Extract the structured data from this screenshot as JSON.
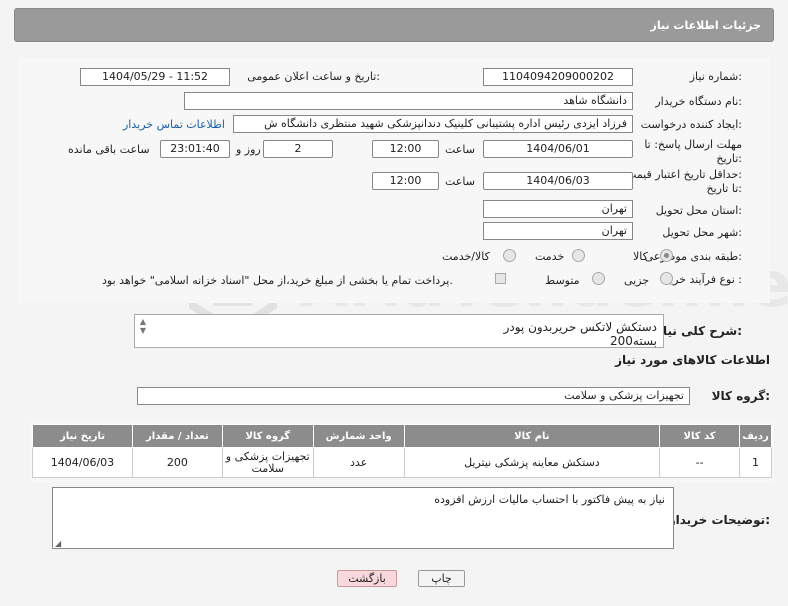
{
  "header": {
    "title": "جزئیات اطلاعات نیاز"
  },
  "form": {
    "need_number_label": "شماره نیاز:",
    "need_number": "1104094209000202",
    "announce_label": "تاریخ و ساعت اعلان عمومی:",
    "announce_value": "1404/05/29 - 11:52",
    "buyer_org_label": "نام دستگاه خریدار:",
    "buyer_org": "دانشگاه شاهد",
    "creator_label": "ایجاد کننده درخواست:",
    "creator": "فرزاد ایزدی رئیس اداره پشتیبانی کلینیک دندانپزشکی شهید منتظری دانشگاه ش",
    "contact_link": "اطلاعات تماس خریدار",
    "deadline_label_1": "مهلت ارسال پاسخ: تا",
    "deadline_label_2": "تاریخ:",
    "deadline_date": "1404/06/01",
    "time_label": "ساعت",
    "deadline_time": "12:00",
    "days_value": "2",
    "days_label": "روز و",
    "remaining_time": "23:01:40",
    "remaining_label": "ساعت باقی مانده",
    "price_validity_label_1": "حداقل تاریخ اعتبار قیمت:",
    "price_validity_label_2": "تا تاریخ:",
    "price_validity_date": "1404/06/03",
    "price_validity_time": "12:00",
    "province_label": "استان محل تحویل:",
    "province": "تهران",
    "city_label": "شهر محل تحویل:",
    "city": "تهران",
    "category_label": "طبقه بندی موضوعی:",
    "category_options": [
      "کالا",
      "خدمت",
      "کالا/خدمت"
    ],
    "category_selected": "کالا",
    "process_label": "نوع فرآیند خرید :",
    "process_options": [
      "جزیی",
      "متوسط"
    ],
    "payment_note": "پرداخت تمام یا بخشی از مبلغ خرید،از محل \"اسناد خزانه اسلامی\" خواهد بود."
  },
  "description": {
    "label": "شرح کلی نیاز:",
    "line1": "دستکش لاتکس حریربدون پودر",
    "line2": "200بسته"
  },
  "goods": {
    "section_title": "اطلاعات کالاهای مورد نیاز",
    "group_label": "گروه کالا:",
    "group_value": "تجهیزات پزشکی و سلامت",
    "columns": [
      "ردیف",
      "کد کالا",
      "نام کالا",
      "واحد شمارش",
      "گروه کالا",
      "تعداد / مقدار",
      "تاریخ نیاز"
    ],
    "rows": [
      {
        "row": "1",
        "code": "--",
        "name": "دستکش معاینه پزشکی نیتریل",
        "unit": "عدد",
        "group": "تجهیزات پزشکی و سلامت",
        "qty": "200",
        "date": "1404/06/03"
      }
    ]
  },
  "notes": {
    "label": "توضیحات خریدار:",
    "text": "نیاز به پیش فاکتور با احتساب مالیات ارزش افزوده"
  },
  "buttons": {
    "print": "چاپ",
    "back": "بازگشت"
  },
  "watermark": "AriaTender.neT"
}
